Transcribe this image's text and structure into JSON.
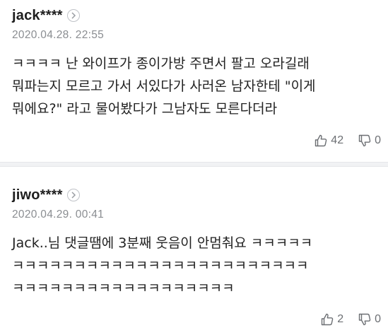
{
  "comments": [
    {
      "author": "jack****",
      "timestamp": "2020.04.28. 22:55",
      "text": "ㅋㅋㅋㅋ 난 와이프가 종이가방 주면서 팔고 오라길래\n뭐파는지 모르고 가서 서있다가 사러온 남자한테 \"이게\n뭐에요?\" 라고 물어봤다가 그남자도 모른다더라",
      "likes": "42",
      "dislikes": "0"
    },
    {
      "author": "jiwo****",
      "timestamp": "2020.04.29. 00:41",
      "text": "Jack..님 댓글땜에 3분째 웃음이 안멈춰요 ㅋㅋㅋㅋㅋ\nㅋㅋㅋㅋㅋㅋㅋㅋㅋㅋㅋㅋㅋㅋㅋㅋㅋㅋㅋㅋㅋㅋㅋㅋ\nㅋㅋㅋㅋㅋㅋㅋㅋㅋㅋㅋㅋㅋㅋㅋㅋㅋㅋ",
      "likes": "2",
      "dislikes": "0"
    }
  ],
  "icons": {
    "author_link": "chevron-right-icon",
    "like": "thumbs-up-icon",
    "dislike": "thumbs-down-icon"
  },
  "colors": {
    "text": "#222222",
    "meta": "#8a8d91",
    "divider": "#f1f2f4"
  }
}
